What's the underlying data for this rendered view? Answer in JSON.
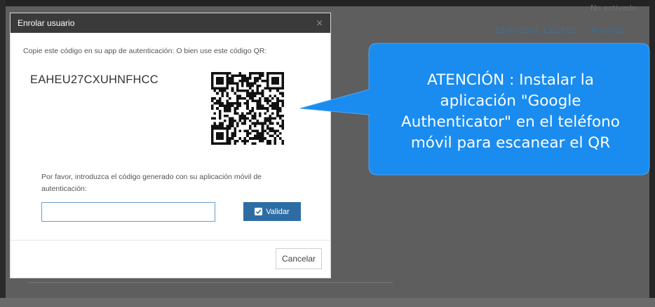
{
  "background": {
    "status_top": "No activado",
    "timestamp": "21/06/2021 13:23:51",
    "status_active": "Activado"
  },
  "modal": {
    "title": "Enrolar usuario",
    "close_symbol": "×",
    "instruction": "Copie este código en su app de autenticación: O bien use este código QR:",
    "secret_code": "EAHEU27CXUHNFHCC",
    "qr_icon": "qr-code",
    "prompt": "Por favor, introduzca el código generado con su aplicación móvil de autenticación:",
    "code_input_value": "",
    "validate_label": "Validar",
    "validate_icon": "check-square",
    "cancel_label": "Cancelar"
  },
  "callout": {
    "lines": [
      "ATENCIÓN : Instalar la",
      "aplicación \"Google",
      "Authenticator\" en el teléfono",
      "móvil  para escanear el QR"
    ],
    "color": "#1a8cf0"
  },
  "colors": {
    "header_bg": "#3a3a3a",
    "primary": "#2e6da4",
    "callout": "#1a8cf0"
  }
}
